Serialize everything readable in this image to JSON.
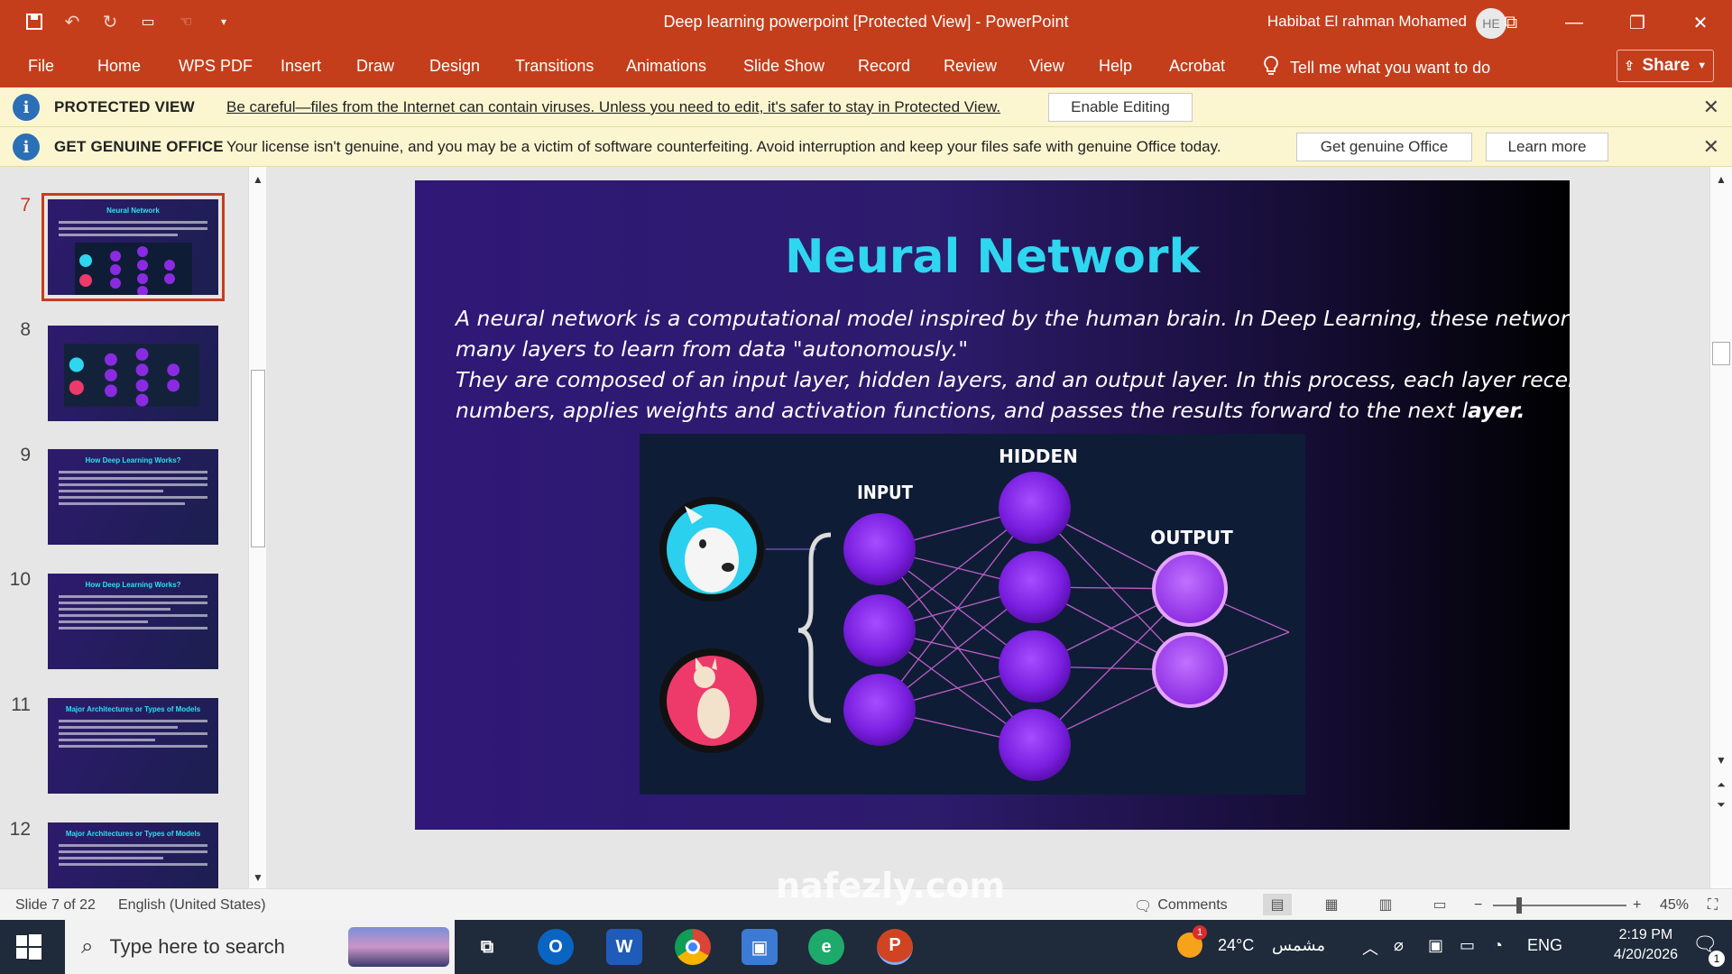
{
  "titlebar": {
    "document_title": "Deep learning powerpoint [Protected View]  -  PowerPoint",
    "user_name": "Habibat El rahman Mohamed",
    "user_initials": "HE"
  },
  "ribbon": {
    "tabs": [
      "File",
      "Home",
      "WPS PDF",
      "Insert",
      "Draw",
      "Design",
      "Transitions",
      "Animations",
      "Slide Show",
      "Record",
      "Review",
      "View",
      "Help",
      "Acrobat"
    ],
    "tell_me": "Tell me what you want to do",
    "share_label": "Share"
  },
  "protected_view": {
    "label": "PROTECTED VIEW",
    "message": "Be careful—files from the Internet can contain viruses. Unless you need to edit, it's safer to stay in Protected View.",
    "button": "Enable Editing"
  },
  "genuine_office": {
    "label": "GET GENUINE OFFICE",
    "message": "Your license isn't genuine, and you may be a victim of software counterfeiting. Avoid interruption and keep your files safe with genuine Office today.",
    "button_primary": "Get genuine Office",
    "button_secondary": "Learn more"
  },
  "thumbnails": [
    {
      "number": "7",
      "title": "Neural Network",
      "selected": true
    },
    {
      "number": "8",
      "title": "",
      "selected": false
    },
    {
      "number": "9",
      "title": "How Deep Learning Works?",
      "selected": false
    },
    {
      "number": "10",
      "title": "How Deep Learning Works?",
      "selected": false
    },
    {
      "number": "11",
      "title": "Major Architectures or Types of Models",
      "selected": false
    },
    {
      "number": "12",
      "title": "Major Architectures or Types of Models",
      "selected": false
    }
  ],
  "slide": {
    "title": "Neural Network",
    "line1": "A neural network is a computational model inspired by the human brain. In Deep Learning, these networks use",
    "line2": "many layers to learn from data \"autonomously.\"",
    "line3": "They are composed of an input layer, hidden layers, and an output layer. In this process, each layer receives",
    "line4a": "numbers, applies weights and activation functions, and passes the results forward to the next l",
    "line4b": "ayer.",
    "diagram": {
      "input_label": "INPUT",
      "hidden_label": "HIDDEN",
      "output_label": "OUTPUT"
    }
  },
  "statusbar": {
    "slide_info": "Slide 7 of 22",
    "language": "English (United States)",
    "comments": "Comments",
    "zoom": "45%"
  },
  "taskbar": {
    "search_placeholder": "Type here to search",
    "weather_temp": "24°C",
    "weather_text": "مشمس",
    "weather_badge": "1",
    "language": "ENG",
    "time": "2:19 PM",
    "date": "4/20/2026",
    "notification_count": "1"
  },
  "watermark": "nafezly.com",
  "colors": {
    "accent": "#c43e1c",
    "slide_title": "#2fd6ef",
    "message_bar": "#fbf6d0",
    "taskbar": "#1f2a3a"
  }
}
